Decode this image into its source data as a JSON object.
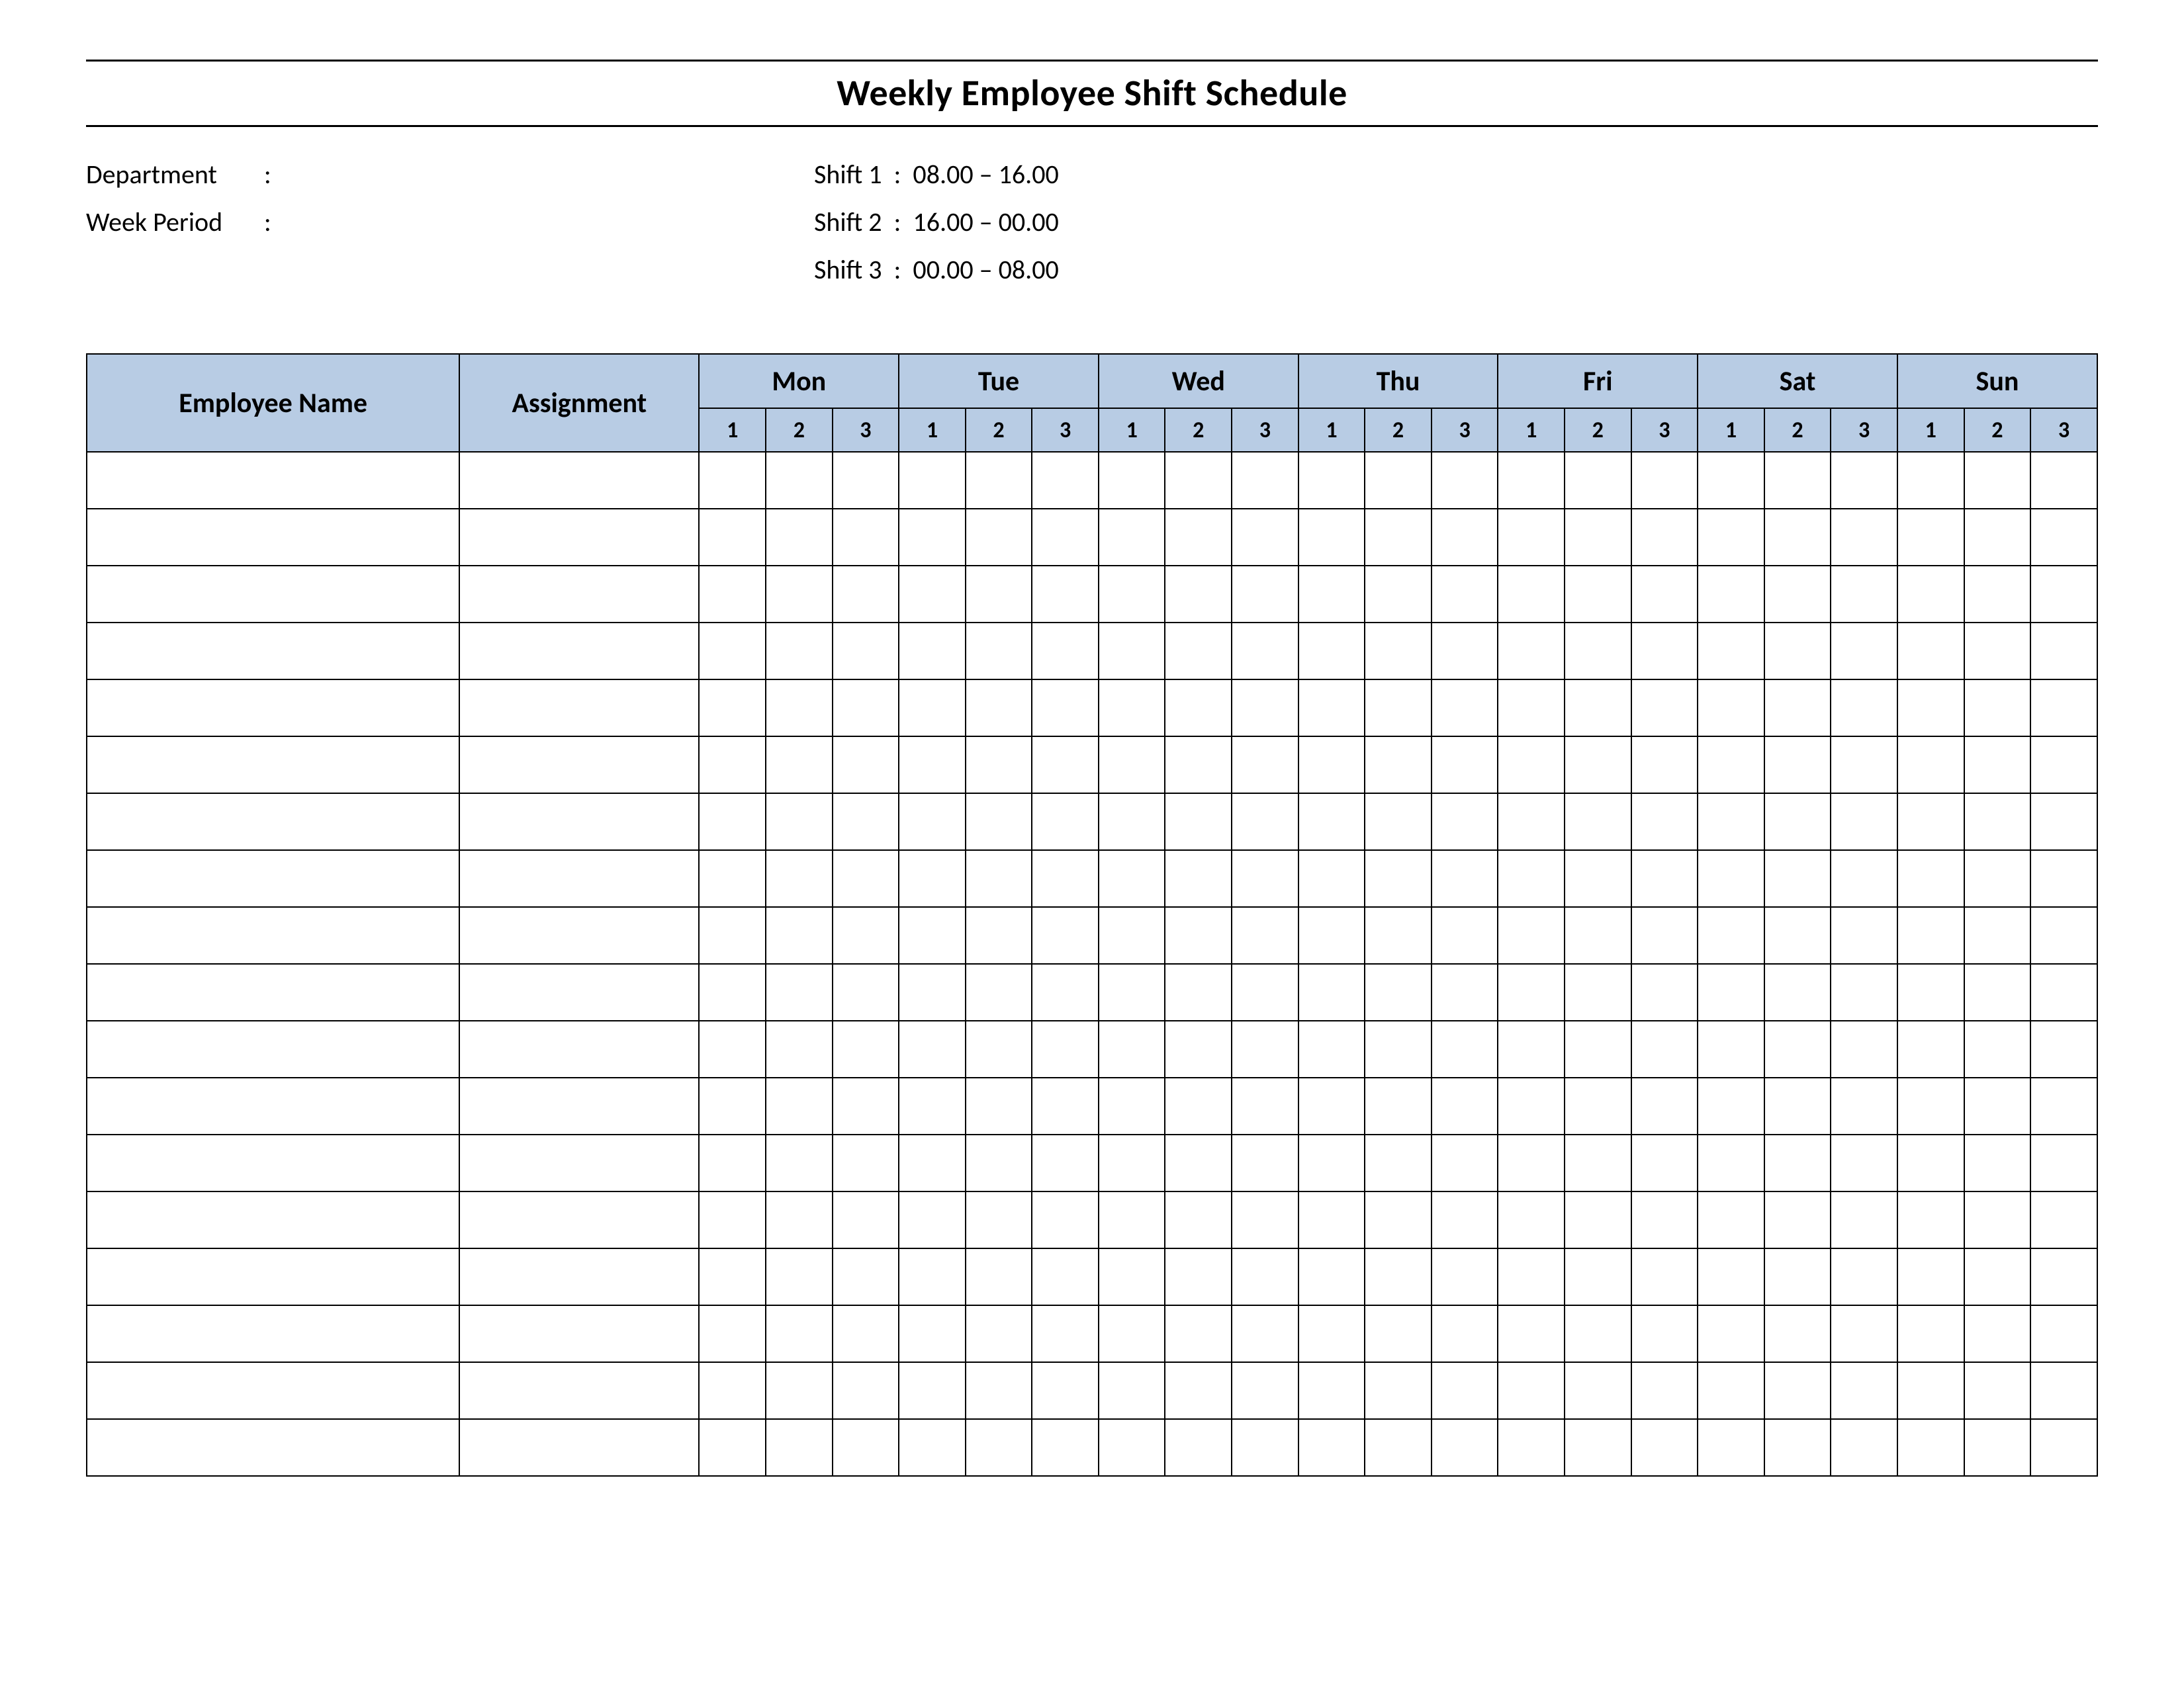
{
  "title": "Weekly Employee Shift Schedule",
  "meta": {
    "department_label": "Department",
    "department_value": "",
    "week_period_label": "Week  Period",
    "week_period_value": "",
    "sep": ":"
  },
  "shift_defs": [
    {
      "label": "Shift 1",
      "sep": ":",
      "range": "08.00  – 16.00"
    },
    {
      "label": "Shift 2",
      "sep": ":",
      "range": "16.00  – 00.00"
    },
    {
      "label": "Shift 3",
      "sep": ":",
      "range": "00.00  – 08.00"
    }
  ],
  "table": {
    "employee_name_header": "Employee Name",
    "assignment_header": "Assignment",
    "days": [
      "Mon",
      "Tue",
      "Wed",
      "Thu",
      "Fri",
      "Sat",
      "Sun"
    ],
    "shift_cols": [
      "1",
      "2",
      "3"
    ],
    "rows": [
      {
        "name": "",
        "assignment": "",
        "shifts": [
          "",
          "",
          "",
          "",
          "",
          "",
          "",
          "",
          "",
          "",
          "",
          "",
          "",
          "",
          "",
          "",
          "",
          "",
          "",
          "",
          ""
        ]
      },
      {
        "name": "",
        "assignment": "",
        "shifts": [
          "",
          "",
          "",
          "",
          "",
          "",
          "",
          "",
          "",
          "",
          "",
          "",
          "",
          "",
          "",
          "",
          "",
          "",
          "",
          "",
          ""
        ]
      },
      {
        "name": "",
        "assignment": "",
        "shifts": [
          "",
          "",
          "",
          "",
          "",
          "",
          "",
          "",
          "",
          "",
          "",
          "",
          "",
          "",
          "",
          "",
          "",
          "",
          "",
          "",
          ""
        ]
      },
      {
        "name": "",
        "assignment": "",
        "shifts": [
          "",
          "",
          "",
          "",
          "",
          "",
          "",
          "",
          "",
          "",
          "",
          "",
          "",
          "",
          "",
          "",
          "",
          "",
          "",
          "",
          ""
        ]
      },
      {
        "name": "",
        "assignment": "",
        "shifts": [
          "",
          "",
          "",
          "",
          "",
          "",
          "",
          "",
          "",
          "",
          "",
          "",
          "",
          "",
          "",
          "",
          "",
          "",
          "",
          "",
          ""
        ]
      },
      {
        "name": "",
        "assignment": "",
        "shifts": [
          "",
          "",
          "",
          "",
          "",
          "",
          "",
          "",
          "",
          "",
          "",
          "",
          "",
          "",
          "",
          "",
          "",
          "",
          "",
          "",
          ""
        ]
      },
      {
        "name": "",
        "assignment": "",
        "shifts": [
          "",
          "",
          "",
          "",
          "",
          "",
          "",
          "",
          "",
          "",
          "",
          "",
          "",
          "",
          "",
          "",
          "",
          "",
          "",
          "",
          ""
        ]
      },
      {
        "name": "",
        "assignment": "",
        "shifts": [
          "",
          "",
          "",
          "",
          "",
          "",
          "",
          "",
          "",
          "",
          "",
          "",
          "",
          "",
          "",
          "",
          "",
          "",
          "",
          "",
          ""
        ]
      },
      {
        "name": "",
        "assignment": "",
        "shifts": [
          "",
          "",
          "",
          "",
          "",
          "",
          "",
          "",
          "",
          "",
          "",
          "",
          "",
          "",
          "",
          "",
          "",
          "",
          "",
          "",
          ""
        ]
      },
      {
        "name": "",
        "assignment": "",
        "shifts": [
          "",
          "",
          "",
          "",
          "",
          "",
          "",
          "",
          "",
          "",
          "",
          "",
          "",
          "",
          "",
          "",
          "",
          "",
          "",
          "",
          ""
        ]
      },
      {
        "name": "",
        "assignment": "",
        "shifts": [
          "",
          "",
          "",
          "",
          "",
          "",
          "",
          "",
          "",
          "",
          "",
          "",
          "",
          "",
          "",
          "",
          "",
          "",
          "",
          "",
          ""
        ]
      },
      {
        "name": "",
        "assignment": "",
        "shifts": [
          "",
          "",
          "",
          "",
          "",
          "",
          "",
          "",
          "",
          "",
          "",
          "",
          "",
          "",
          "",
          "",
          "",
          "",
          "",
          "",
          ""
        ]
      },
      {
        "name": "",
        "assignment": "",
        "shifts": [
          "",
          "",
          "",
          "",
          "",
          "",
          "",
          "",
          "",
          "",
          "",
          "",
          "",
          "",
          "",
          "",
          "",
          "",
          "",
          "",
          ""
        ]
      },
      {
        "name": "",
        "assignment": "",
        "shifts": [
          "",
          "",
          "",
          "",
          "",
          "",
          "",
          "",
          "",
          "",
          "",
          "",
          "",
          "",
          "",
          "",
          "",
          "",
          "",
          "",
          ""
        ]
      },
      {
        "name": "",
        "assignment": "",
        "shifts": [
          "",
          "",
          "",
          "",
          "",
          "",
          "",
          "",
          "",
          "",
          "",
          "",
          "",
          "",
          "",
          "",
          "",
          "",
          "",
          "",
          ""
        ]
      },
      {
        "name": "",
        "assignment": "",
        "shifts": [
          "",
          "",
          "",
          "",
          "",
          "",
          "",
          "",
          "",
          "",
          "",
          "",
          "",
          "",
          "",
          "",
          "",
          "",
          "",
          "",
          ""
        ]
      },
      {
        "name": "",
        "assignment": "",
        "shifts": [
          "",
          "",
          "",
          "",
          "",
          "",
          "",
          "",
          "",
          "",
          "",
          "",
          "",
          "",
          "",
          "",
          "",
          "",
          "",
          "",
          ""
        ]
      },
      {
        "name": "",
        "assignment": "",
        "shifts": [
          "",
          "",
          "",
          "",
          "",
          "",
          "",
          "",
          "",
          "",
          "",
          "",
          "",
          "",
          "",
          "",
          "",
          "",
          "",
          "",
          ""
        ]
      }
    ]
  }
}
